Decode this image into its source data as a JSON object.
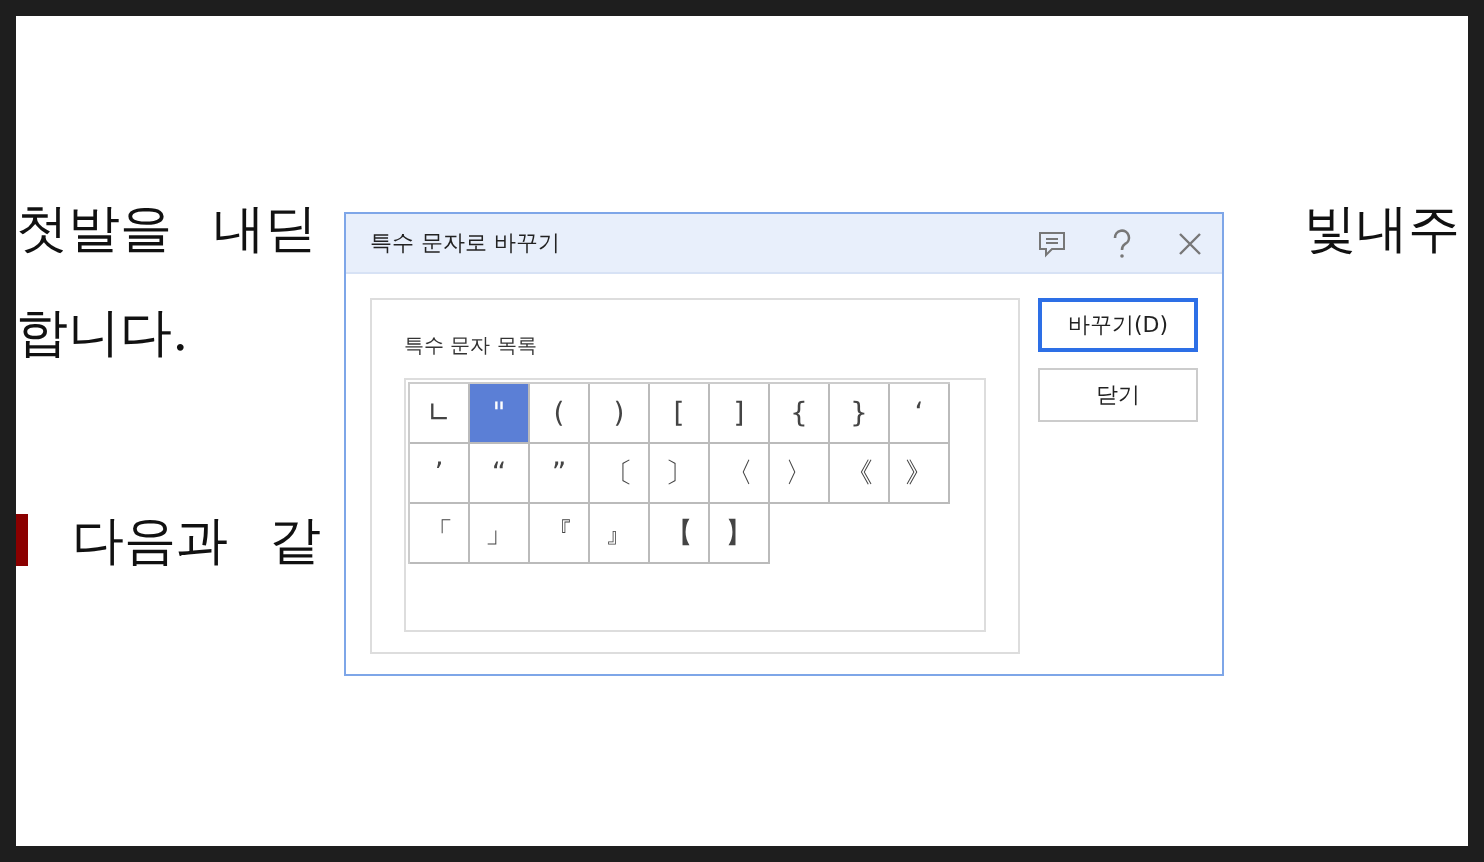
{
  "document": {
    "lines": [
      {
        "left": "첫발을 내딛",
        "right": "빛내주",
        "marker": false
      },
      {
        "left": "합니다.",
        "marker": false
      },
      {
        "left": "다음과 같",
        "marker": true
      }
    ]
  },
  "dialog": {
    "title": "특수 문자로 바꾸기",
    "group_label": "특수 문자 목록",
    "symbols": [
      {
        "char": "∟",
        "selected": false
      },
      {
        "char": "\"",
        "selected": true
      },
      {
        "char": "(",
        "selected": false
      },
      {
        "char": ")",
        "selected": false
      },
      {
        "char": "[",
        "selected": false
      },
      {
        "char": "]",
        "selected": false
      },
      {
        "char": "{",
        "selected": false
      },
      {
        "char": "}",
        "selected": false
      },
      {
        "char": "‘",
        "selected": false
      },
      {
        "char": "’",
        "selected": false
      },
      {
        "char": "“",
        "selected": false
      },
      {
        "char": "”",
        "selected": false
      },
      {
        "char": "〔",
        "selected": false
      },
      {
        "char": "〕",
        "selected": false
      },
      {
        "char": "〈",
        "selected": false
      },
      {
        "char": "〉",
        "selected": false
      },
      {
        "char": "《",
        "selected": false
      },
      {
        "char": "》",
        "selected": false
      },
      {
        "char": "「",
        "selected": false
      },
      {
        "char": "」",
        "selected": false
      },
      {
        "char": "『",
        "selected": false
      },
      {
        "char": "』",
        "selected": false
      },
      {
        "char": "【",
        "selected": false
      },
      {
        "char": "】",
        "selected": false
      }
    ],
    "buttons": [
      {
        "label": "바꾸기(D)",
        "primary": true
      },
      {
        "label": "닫기",
        "primary": false
      }
    ]
  }
}
